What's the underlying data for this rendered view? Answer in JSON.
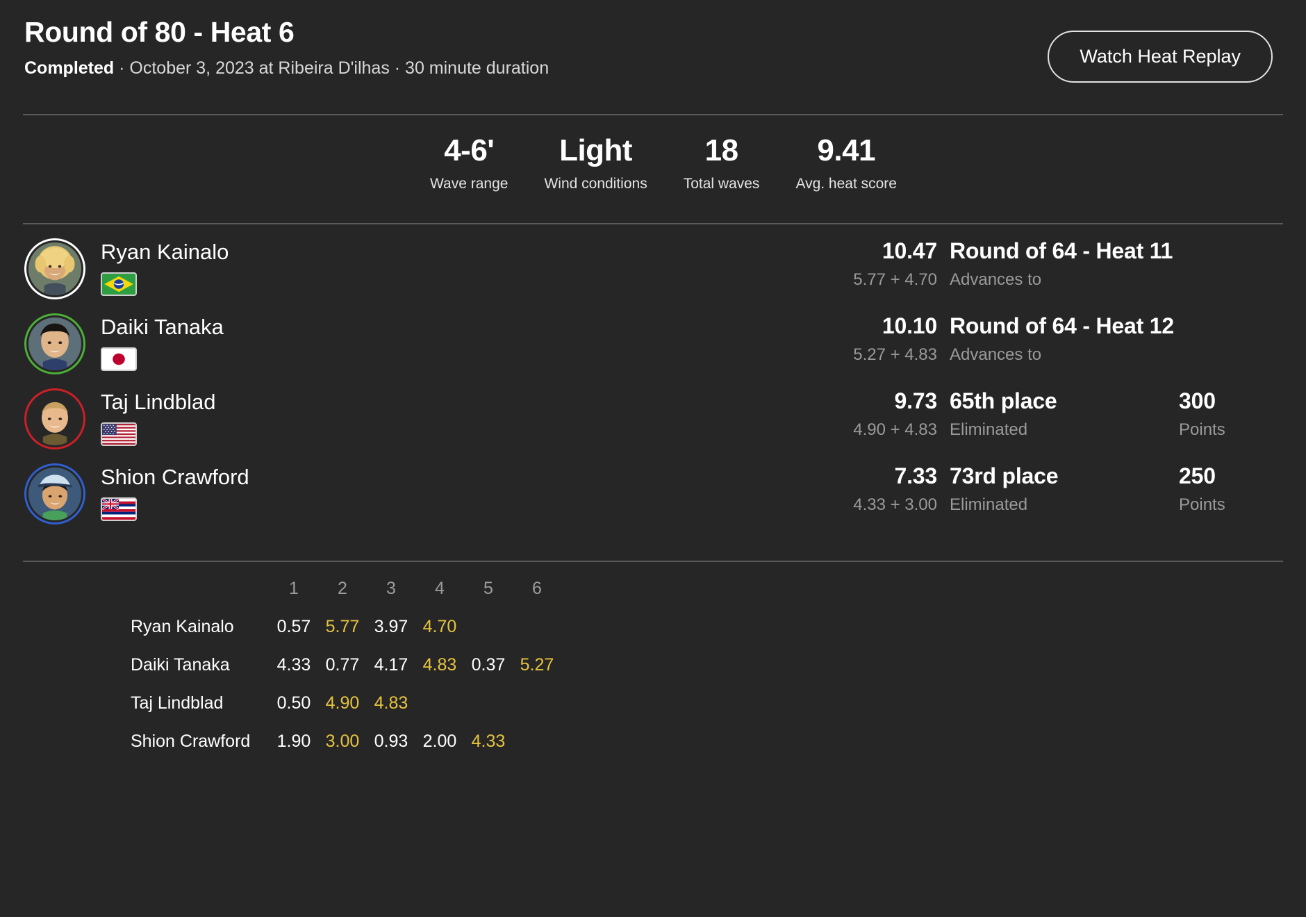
{
  "header": {
    "title": "Round of 80 - Heat 6",
    "status": "Completed",
    "meta_rest": " · October 3, 2023 at Ribeira D'ilhas · 30 minute duration",
    "replay_button": "Watch Heat Replay"
  },
  "stats": [
    {
      "value": "4-6'",
      "label": "Wave range"
    },
    {
      "value": "Light",
      "label": "Wind conditions"
    },
    {
      "value": "18",
      "label": "Total waves"
    },
    {
      "value": "9.41",
      "label": "Avg. heat score"
    }
  ],
  "surfers": [
    {
      "name": "Ryan Kainalo",
      "country": "Brazil",
      "flag": "br",
      "ring_color": "#ffffff",
      "total": "10.47",
      "breakdown": "5.77 + 4.70",
      "result": "Round of 64 - Heat 11",
      "result_sub": "Advances to",
      "points": "",
      "points_label": ""
    },
    {
      "name": "Daiki Tanaka",
      "country": "Japan",
      "flag": "jp",
      "ring_color": "#4caf37",
      "total": "10.10",
      "breakdown": "5.27 + 4.83",
      "result": "Round of 64 - Heat 12",
      "result_sub": "Advances to",
      "points": "",
      "points_label": ""
    },
    {
      "name": "Taj Lindblad",
      "country": "United States",
      "flag": "us",
      "ring_color": "#cc2026",
      "total": "9.73",
      "breakdown": "4.90 + 4.83",
      "result": "65th place",
      "result_sub": "Eliminated",
      "points": "300",
      "points_label": "Points"
    },
    {
      "name": "Shion Crawford",
      "country": "Hawaii",
      "flag": "hi",
      "ring_color": "#2f5fd0",
      "total": "7.33",
      "breakdown": "4.33 + 3.00",
      "result": "73rd place",
      "result_sub": "Eliminated",
      "points": "250",
      "points_label": "Points"
    }
  ],
  "wave_table": {
    "columns": [
      "1",
      "2",
      "3",
      "4",
      "5",
      "6"
    ],
    "rows": [
      {
        "name": "Ryan Kainalo",
        "scores": [
          "0.57",
          "5.77",
          "3.97",
          "4.70",
          "",
          ""
        ],
        "counted": [
          false,
          true,
          false,
          true,
          false,
          false
        ]
      },
      {
        "name": "Daiki Tanaka",
        "scores": [
          "4.33",
          "0.77",
          "4.17",
          "4.83",
          "0.37",
          "5.27"
        ],
        "counted": [
          false,
          false,
          false,
          true,
          false,
          true
        ]
      },
      {
        "name": "Taj Lindblad",
        "scores": [
          "0.50",
          "4.90",
          "4.83",
          "",
          "",
          ""
        ],
        "counted": [
          false,
          true,
          true,
          false,
          false,
          false
        ]
      },
      {
        "name": "Shion Crawford",
        "scores": [
          "1.90",
          "3.00",
          "0.93",
          "2.00",
          "4.33",
          ""
        ],
        "counted": [
          false,
          true,
          false,
          false,
          true,
          false
        ]
      }
    ]
  },
  "colors": {
    "background": "#262626",
    "counted_score": "#e6c33f",
    "muted_text": "#9a9a9a",
    "divider": "#5a5a5a"
  }
}
